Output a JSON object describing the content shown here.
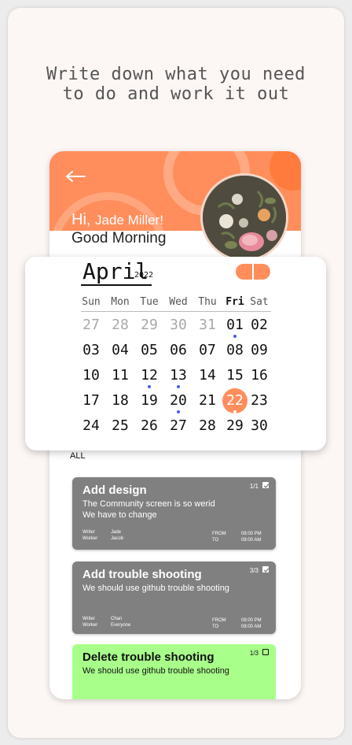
{
  "headline": [
    "Write down what you need",
    "to do and work it out"
  ],
  "header": {
    "greeting_hi": "Hi,",
    "greeting_name": "Jade Miller!",
    "greeting_time": "Good Morning"
  },
  "calendar": {
    "month": "April",
    "year": "2022",
    "weekdays": [
      "Sun",
      "Mon",
      "Tue",
      "Wed",
      "Thu",
      "Fri",
      "Sat"
    ],
    "active_weekday": "Fri",
    "weeks": [
      [
        "27",
        "28",
        "29",
        "30",
        "31",
        "01",
        "02"
      ],
      [
        "03",
        "04",
        "05",
        "06",
        "07",
        "08",
        "09"
      ],
      [
        "10",
        "11",
        "12",
        "13",
        "14",
        "15",
        "16"
      ],
      [
        "17",
        "18",
        "19",
        "20",
        "21",
        "22",
        "23"
      ],
      [
        "24",
        "25",
        "26",
        "27",
        "28",
        "29",
        "30"
      ]
    ],
    "muted_days": [
      "27",
      "28",
      "29",
      "30",
      "31"
    ],
    "selected_day": "22",
    "dotted_days": [
      "01",
      "12",
      "13",
      "20",
      "22"
    ]
  },
  "filter_label": "ALL",
  "tasks": [
    {
      "title": "Add design",
      "description": [
        "The Community screen is so werid",
        "We have to change"
      ],
      "count": "1/1",
      "checked": true,
      "writer_label": "Writer",
      "writer": "Jade",
      "worker_label": "Worker",
      "worker": "Jacob",
      "from_label": "FROM",
      "from": "08:00 PM",
      "to_label": "TO",
      "to": "08:00 AM"
    },
    {
      "title": "Add trouble shooting",
      "description": [
        "We should use github trouble shooting"
      ],
      "count": "3/3",
      "checked": true,
      "writer_label": "Writer",
      "writer": "Chan",
      "worker_label": "Worker",
      "worker": "Everyone",
      "from_label": "FROM",
      "from": "08:00 PM",
      "to_label": "TO",
      "to": "08:00 AM"
    },
    {
      "title": "Delete trouble shooting",
      "description": [
        "We should use github trouble shooting"
      ],
      "count": "1/3",
      "checked": false
    }
  ],
  "colors": {
    "accent": "#ff8e5c",
    "card_done": "#808080",
    "card_active": "#a8ff8a",
    "event_dot": "#4a5cf0"
  },
  "icons": {
    "back": "arrow-left-icon",
    "check": "checkbox-icon",
    "toggle": "pill-toggle-icon"
  }
}
